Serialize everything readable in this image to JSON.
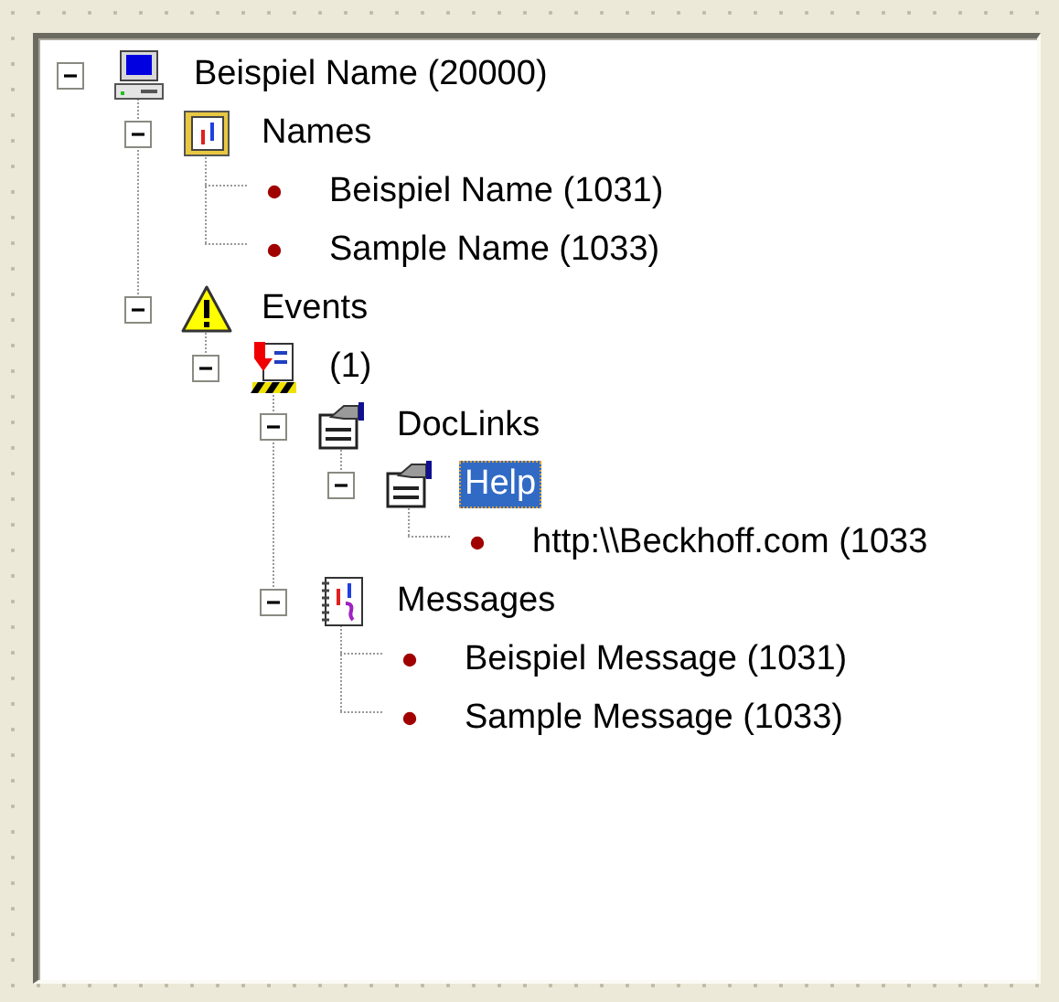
{
  "tree": [
    {
      "label": "Beispiel Name (20000)",
      "kind": "computer",
      "expanded": true,
      "selected": false,
      "children": [
        {
          "label": "Names",
          "kind": "names",
          "expanded": true,
          "selected": false,
          "children": [
            {
              "label": "Beispiel Name (1031)",
              "kind": "bullet",
              "selected": false
            },
            {
              "label": "Sample Name (1033)",
              "kind": "bullet",
              "selected": false
            }
          ]
        },
        {
          "label": "Events",
          "kind": "warning",
          "expanded": true,
          "selected": false,
          "children": [
            {
              "label": "(1)",
              "kind": "event",
              "expanded": true,
              "selected": false,
              "children": [
                {
                  "label": "DocLinks",
                  "kind": "doclink",
                  "expanded": true,
                  "selected": false,
                  "children": [
                    {
                      "label": "Help",
                      "kind": "doclink",
                      "expanded": true,
                      "selected": true,
                      "children": [
                        {
                          "label": "http:\\\\Beckhoff.com (1033",
                          "kind": "bullet",
                          "selected": false
                        }
                      ]
                    }
                  ]
                },
                {
                  "label": "Messages",
                  "kind": "messages",
                  "expanded": true,
                  "selected": false,
                  "children": [
                    {
                      "label": "Beispiel Message (1031)",
                      "kind": "bullet",
                      "selected": false
                    },
                    {
                      "label": "Sample Message (1033)",
                      "kind": "bullet",
                      "selected": false
                    }
                  ]
                }
              ]
            }
          ]
        }
      ]
    }
  ]
}
